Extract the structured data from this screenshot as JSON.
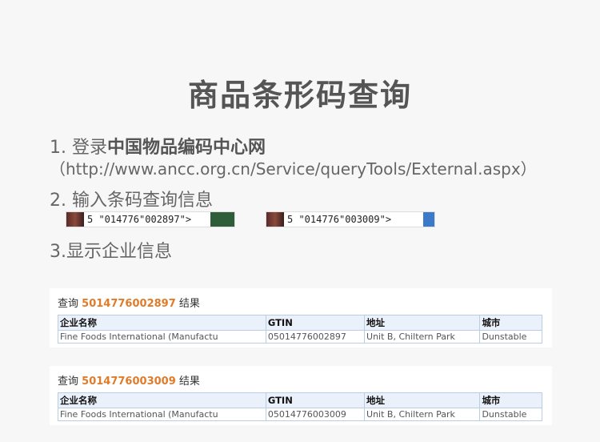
{
  "title": "商品条形码查询",
  "step1": {
    "prefix": "1. 登录",
    "site_name": "中国物品编码中心网",
    "url": "（http://www.ancc.org.cn/Service/queryTools/External.aspx）"
  },
  "step2": {
    "label": "2. 输入条码查询信息"
  },
  "barcodes": [
    {
      "text": "5 \"014776\"002897\">"
    },
    {
      "text": "5 \"014776\"003009\">"
    }
  ],
  "step3": {
    "label": "3.显示企业信息"
  },
  "results": [
    {
      "query_prefix": "查询",
      "code": "5014776002897",
      "query_suffix": "结果",
      "headers": [
        "企业名称",
        "GTIN",
        "地址",
        "城市"
      ],
      "row": [
        "Fine Foods International (Manufactu",
        "05014776002897",
        "Unit B, Chiltern Park",
        "Dunstable"
      ]
    },
    {
      "query_prefix": "查询",
      "code": "5014776003009",
      "query_suffix": "结果",
      "headers": [
        "企业名称",
        "GTIN",
        "地址",
        "城市"
      ],
      "row": [
        "Fine Foods International (Manufactu",
        "05014776003009",
        "Unit B, Chiltern Park",
        "Dunstable"
      ]
    }
  ]
}
